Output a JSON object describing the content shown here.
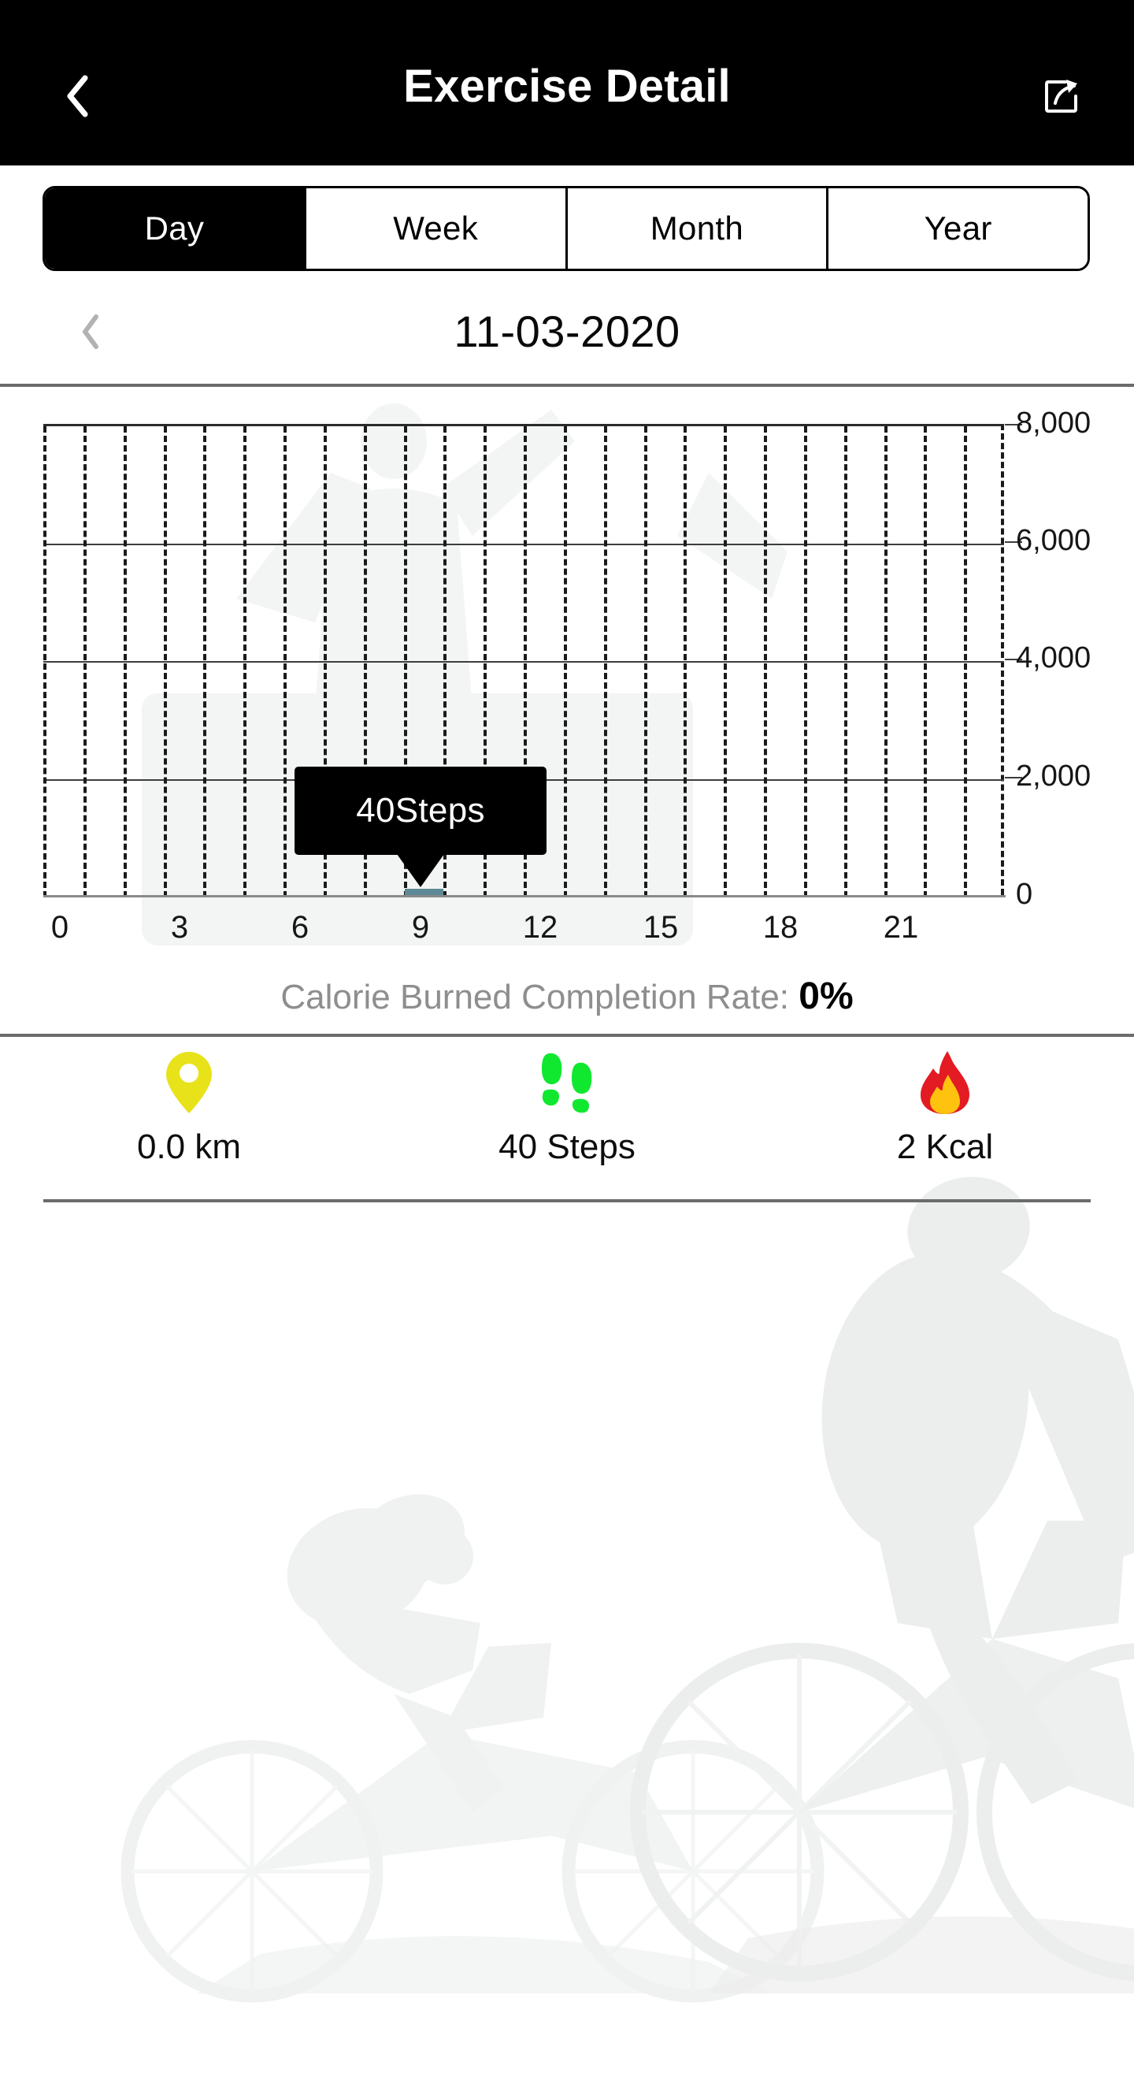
{
  "header": {
    "title": "Exercise Detail",
    "back_icon": "chevron-left-icon",
    "share_icon": "share-icon"
  },
  "period_tabs": {
    "selected": "Day",
    "items": [
      {
        "label": "Day",
        "active": true
      },
      {
        "label": "Week",
        "active": false
      },
      {
        "label": "Month",
        "active": false
      },
      {
        "label": "Year",
        "active": false
      }
    ]
  },
  "date_nav": {
    "prev_icon": "chevron-left-icon",
    "date": "11-03-2020"
  },
  "tooltip": {
    "text": "40Steps"
  },
  "completion_rate": {
    "label": "Calorie Burned Completion Rate:",
    "value": "0%"
  },
  "stats": [
    {
      "icon": "location-pin-icon",
      "value": "0.0 km",
      "color": "#e8e21a"
    },
    {
      "icon": "footsteps-icon",
      "value": "40 Steps",
      "color": "#10e830"
    },
    {
      "icon": "flame-icon",
      "value": "2 Kcal",
      "color": "#e31b23"
    }
  ],
  "colors": {
    "header_bg": "#000000",
    "accent_bar": "#5d8a96",
    "divider": "#6b6b6b",
    "rate_label": "#8e8e8e"
  },
  "chart_data": {
    "type": "bar",
    "title": "",
    "xlabel": "",
    "ylabel": "",
    "x_tick_labels": [
      "0",
      "3",
      "6",
      "9",
      "12",
      "15",
      "18",
      "21"
    ],
    "x_tick_values": [
      0,
      3,
      6,
      9,
      12,
      15,
      18,
      21
    ],
    "y_tick_labels": [
      "8,000",
      "6,000",
      "4,000",
      "2,000",
      "0"
    ],
    "y_tick_values": [
      8000,
      6000,
      4000,
      2000,
      0
    ],
    "xlim": [
      0,
      24
    ],
    "ylim": [
      0,
      8000
    ],
    "grid": "vertical-dashed-horizontal-solid",
    "legend": "none",
    "bar_color": "#5d8a96",
    "categories": [
      0,
      1,
      2,
      3,
      4,
      5,
      6,
      7,
      8,
      9,
      10,
      11,
      12,
      13,
      14,
      15,
      16,
      17,
      18,
      19,
      20,
      21,
      22,
      23
    ],
    "values": [
      0,
      0,
      0,
      0,
      0,
      0,
      0,
      0,
      0,
      40,
      0,
      0,
      0,
      0,
      0,
      0,
      0,
      0,
      0,
      0,
      0,
      0,
      0,
      0
    ],
    "annotation": {
      "x": 9,
      "text": "40Steps",
      "value": 40
    }
  }
}
